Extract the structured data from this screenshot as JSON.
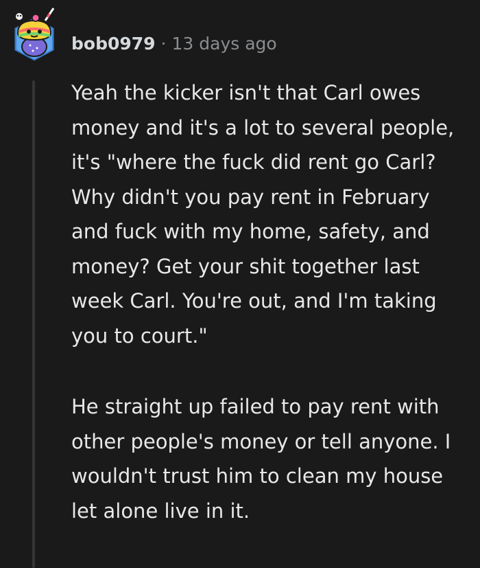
{
  "comment": {
    "username": "bob0979",
    "separator": "·",
    "timestamp": "13 days ago",
    "avatar_icon": "snoo-rainbow-cupcake-avatar",
    "paragraphs": [
      "Yeah the kicker isn't that Carl owes money and it's a lot to several people, it's \"where the fuck did rent go Carl? Why didn't you pay rent in February and fuck with my home, safety, and money? Get your shit together last week Carl. You're out, and I'm taking you to court.\"",
      "He straight up failed to pay rent with other people's money or tell anyone. I wouldn't trust him to clean my house let alone live in it."
    ]
  },
  "colors": {
    "background": "#1a1a1b",
    "text": "#e8e8e8",
    "muted": "#8b8e91",
    "thread_line": "#343536"
  }
}
